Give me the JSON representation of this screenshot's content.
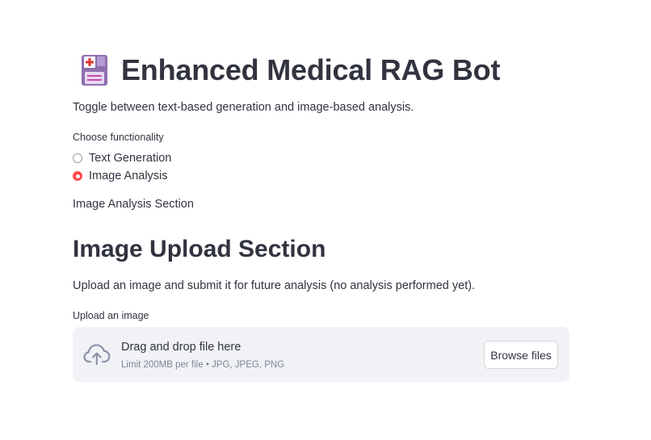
{
  "header": {
    "icon": "floppy-disk-medical-icon",
    "title": "Enhanced Medical RAG Bot"
  },
  "intro": {
    "text": "Toggle between text-based generation and image-based analysis."
  },
  "functionality": {
    "label": "Choose functionality",
    "options": [
      {
        "label": "Text Generation",
        "selected": false
      },
      {
        "label": "Image Analysis",
        "selected": true
      }
    ]
  },
  "section_note": "Image Analysis Section",
  "upload_section": {
    "heading": "Image Upload Section",
    "description": "Upload an image and submit it for future analysis (no analysis performed yet).",
    "uploader_label": "Upload an image",
    "dropzone_text": "Drag and drop file here",
    "dropzone_limit": "Limit 200MB per file • JPG, JPEG, PNG",
    "browse_button": "Browse files",
    "icon": "cloud-upload-icon"
  },
  "colors": {
    "accent": "#ff4b4b",
    "text": "#31333f",
    "dropzone_bg": "#f0f2f6",
    "muted": "#808495"
  }
}
